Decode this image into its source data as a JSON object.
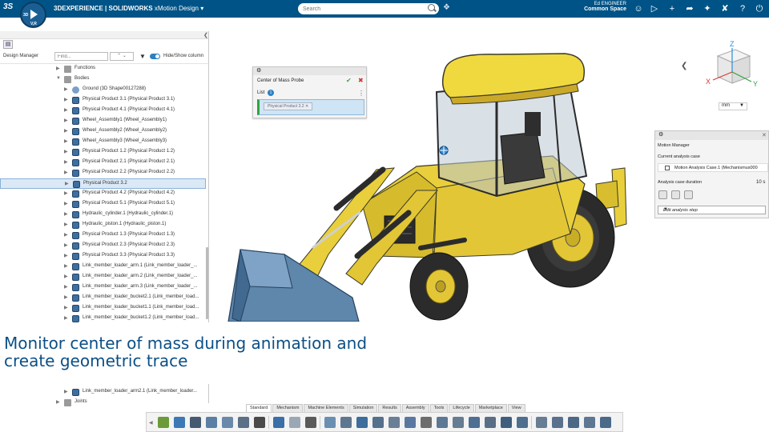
{
  "app": {
    "brand_prefix": "3DEXPERIENCE | SOLIDWORKS",
    "app_name": "xMotion Design",
    "search_placeholder": "Search",
    "user_name": "Ed ENGINEER",
    "space": "Common Space",
    "compass_letters": [
      "3D",
      "V,R"
    ]
  },
  "tree_panel": {
    "title": "Design Manager",
    "find_placeholder": "Find...",
    "hide_show_label": "Hide/Show column",
    "rows": [
      {
        "label": "Functions",
        "indent": 1,
        "icon": "folder",
        "arrow": "collapsed"
      },
      {
        "label": "Bodies",
        "indent": 1,
        "icon": "folder",
        "arrow": "expanded"
      },
      {
        "label": "Ground (3D Shape00127288)",
        "indent": 2,
        "icon": "ground",
        "arrow": "collapsed"
      },
      {
        "label": "Physical Product 3.1 (Physical Product 3.1)",
        "indent": 2,
        "icon": "body",
        "arrow": "collapsed"
      },
      {
        "label": "Physical Product 4.1 (Physical Product 4.1)",
        "indent": 2,
        "icon": "body",
        "arrow": "collapsed"
      },
      {
        "label": "Wheel_Assembly1 (Wheel_Assembly1)",
        "indent": 2,
        "icon": "body",
        "arrow": "collapsed"
      },
      {
        "label": "Wheel_Assembly2 (Wheel_Assembly2)",
        "indent": 2,
        "icon": "body",
        "arrow": "collapsed"
      },
      {
        "label": "Wheel_Assembly3 (Wheel_Assembly3)",
        "indent": 2,
        "icon": "body",
        "arrow": "collapsed"
      },
      {
        "label": "Physical Product 1.2 (Physical Product 1.2)",
        "indent": 2,
        "icon": "body",
        "arrow": "collapsed"
      },
      {
        "label": "Physical Product 2.1 (Physical Product 2.1)",
        "indent": 2,
        "icon": "body",
        "arrow": "collapsed"
      },
      {
        "label": "Physical Product 2.2 (Physical Product 2.2)",
        "indent": 2,
        "icon": "body",
        "arrow": "collapsed"
      },
      {
        "label": "Physical Product 3.2",
        "indent": 2,
        "icon": "body",
        "arrow": "collapsed",
        "selected": true
      },
      {
        "label": "Physical Product 4.2 (Physical Product 4.2)",
        "indent": 2,
        "icon": "body",
        "arrow": "collapsed"
      },
      {
        "label": "Physical Product 5.1 (Physical Product 5.1)",
        "indent": 2,
        "icon": "body",
        "arrow": "collapsed"
      },
      {
        "label": "Hydraulic_cylinder.1 (Hydraulic_cylinder.1)",
        "indent": 2,
        "icon": "body",
        "arrow": "collapsed"
      },
      {
        "label": "Hydraulic_piston.1 (Hydraulic_piston.1)",
        "indent": 2,
        "icon": "body",
        "arrow": "collapsed"
      },
      {
        "label": "Physical Product 1.3 (Physical Product 1.3)",
        "indent": 2,
        "icon": "body",
        "arrow": "collapsed"
      },
      {
        "label": "Physical Product 2.3 (Physical Product 2.3)",
        "indent": 2,
        "icon": "body",
        "arrow": "collapsed"
      },
      {
        "label": "Physical Product 3.3 (Physical Product 3.3)",
        "indent": 2,
        "icon": "body",
        "arrow": "collapsed"
      },
      {
        "label": "Link_member_loader_arm.1 (Link_member_loader_...",
        "indent": 2,
        "icon": "body",
        "arrow": "collapsed"
      },
      {
        "label": "Link_member_loader_arm.2 (Link_member_loader_...",
        "indent": 2,
        "icon": "body",
        "arrow": "collapsed"
      },
      {
        "label": "Link_member_loader_arm.3 (Link_member_loader_...",
        "indent": 2,
        "icon": "body",
        "arrow": "collapsed"
      },
      {
        "label": "Link_member_loader_bucket2.1 (Link_member_load...",
        "indent": 2,
        "icon": "body",
        "arrow": "collapsed"
      },
      {
        "label": "Link_member_loader_bucket1.1 (Link_member_load...",
        "indent": 2,
        "icon": "body",
        "arrow": "collapsed"
      },
      {
        "label": "Link_member_loader_bucket1.2 (Link_member_load...",
        "indent": 2,
        "icon": "body",
        "arrow": "collapsed"
      }
    ],
    "tail_rows": [
      {
        "label": "Link_member_loader_arm2.1 (Link_member_loader...",
        "icon": "body"
      },
      {
        "label": "Joints",
        "icon": "folder"
      }
    ]
  },
  "caption": "Monitor center of mass during animation and create geometric trace",
  "com_probe": {
    "title": "Center of Mass Probe",
    "list_label": "List",
    "list_count": "1",
    "chip_label": "Physical Product 3.2"
  },
  "view": {
    "units": "mm",
    "axes": [
      "X",
      "Y",
      "Z"
    ]
  },
  "motion_manager": {
    "title": "Motion Manager",
    "current_case_label": "Current analysis case",
    "case_name": "Motion Analysis Case.1 (Mechanismus000",
    "duration_label": "Analysis case duration",
    "duration_value": "10 s",
    "edit_step": "Edit analysis step"
  },
  "bottom_tabs": [
    {
      "label": "Standard",
      "active": true
    },
    {
      "label": "Mechanism",
      "active": false
    },
    {
      "label": "Machine Elements",
      "active": false
    },
    {
      "label": "Simulation",
      "active": false
    },
    {
      "label": "Results",
      "active": false
    },
    {
      "label": "Assembly",
      "active": false
    },
    {
      "label": "Tools",
      "active": false
    },
    {
      "label": "Lifecycle",
      "active": false
    },
    {
      "label": "Marketplace",
      "active": false
    },
    {
      "label": "View",
      "active": false
    }
  ],
  "colors": {
    "topbar": "#005386",
    "accent": "#2c7fc1",
    "caption": "#0b4f86",
    "body_yellow": "#e9cf3b",
    "bucket_blue": "#5f86ab"
  }
}
